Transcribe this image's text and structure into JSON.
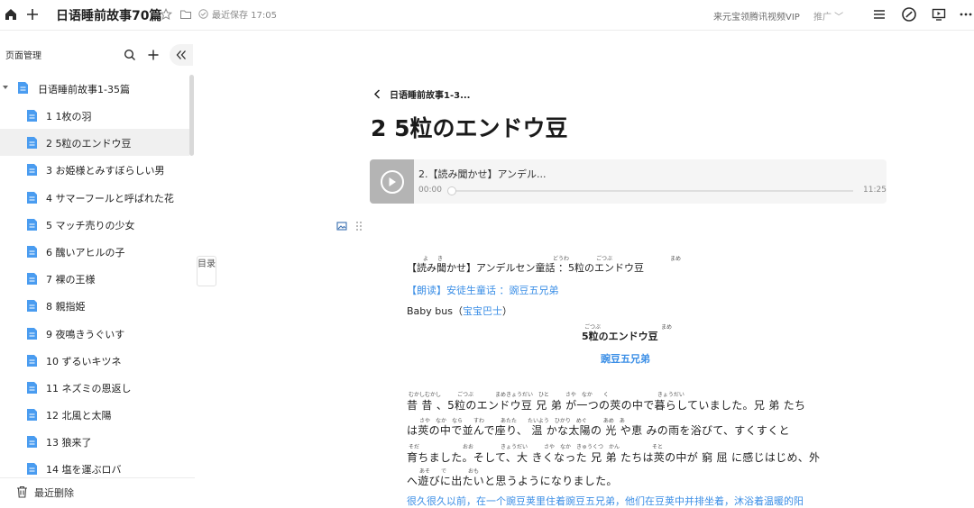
{
  "topbar": {
    "title": "日语睡前故事70篇",
    "saved": "最近保存 17:05",
    "vip": "来元宝领腾讯视频VIP",
    "promo": "推广"
  },
  "sidebar": {
    "title": "页面管理",
    "root": "日语睡前故事1-35篇",
    "items": [
      {
        "label": "1 1枚の羽"
      },
      {
        "label": "2 5粒のエンドウ豆"
      },
      {
        "label": "3 お姫様とみすぼらしい男"
      },
      {
        "label": "4 サマーフールと呼ばれた花"
      },
      {
        "label": "5 マッチ売りの少女"
      },
      {
        "label": "6 醜いアヒルの子"
      },
      {
        "label": "7 裸の王様"
      },
      {
        "label": "8 親指姫"
      },
      {
        "label": "9 夜鳴きうぐいす"
      },
      {
        "label": "10 ずるいキツネ"
      },
      {
        "label": "11 ネズミの恩返し"
      },
      {
        "label": "12 北風と太陽"
      },
      {
        "label": "13 狼来了"
      },
      {
        "label": "14 塩を運ぶロバ"
      }
    ],
    "active_index": 1,
    "footer": "最近删除"
  },
  "toc": "目录",
  "main": {
    "back_label": "日语睡前故事1-3...",
    "title": "2 5粒のエンドウ豆",
    "audio": {
      "title": "2.【読み聞かせ】アンデル...",
      "current": "00:00",
      "total": "11:25",
      "progress": 0
    },
    "lines": {
      "l1": "【読み聞かせ】アンデルセン童話 ：5粒のエンドウ豆",
      "l2": "【朗读】安徒生童话 ：豌豆五兄弟",
      "l3_prefix": "Baby bus（",
      "l3_blue": "宝宝巴士",
      "l3_suffix": "）",
      "heading_jp": "5粒のエンドウ豆",
      "heading_cn": "豌豆五兄弟",
      "p1": "昔 昔 、5粒のエンドウ豆 兄 弟 が一つの莢の中で暮らしていました。兄 弟 たち",
      "p2": "は莢の中で並んで座り、 温 かな太陽の 光 や恵 みの雨を浴びて、すくすくと",
      "p3": "育ちました。そして、大 きくなった 兄 弟 たちは莢の中が 窮 屈 に感じはじめ、外",
      "p4": "へ遊びに出たいと思うようになりました。",
      "p5": "很久很久以前，在一个豌豆荚里住着豌豆五兄弟，他们在豆荚中并排坐着，沐浴着温暖的阳"
    },
    "ruby": {
      "r1a": "よ",
      "r1b": "き",
      "r1c": "どうわ",
      "r1d": "ごつぶ",
      "r1e": "まめ",
      "r4a": "ごつぶ",
      "r4b": "まめ",
      "rp1": "むかしむかし　　　ごつぶ　　　　まめきょうだい　ひと　　　さや　なか　　く　　　　　　　　　きょうだい",
      "rp2": "さや　なか　なら　　すわ　　　あたた　　たいよう　ひかり　めぐ　　　あめ　あ",
      "rp3": "そだ　　　　　　　　おお　　　　　きょうだい　　　さや　なか　きゅうくつ　かん　　　　　　そと",
      "rp4": "あそ　　で　　　　おも"
    }
  }
}
